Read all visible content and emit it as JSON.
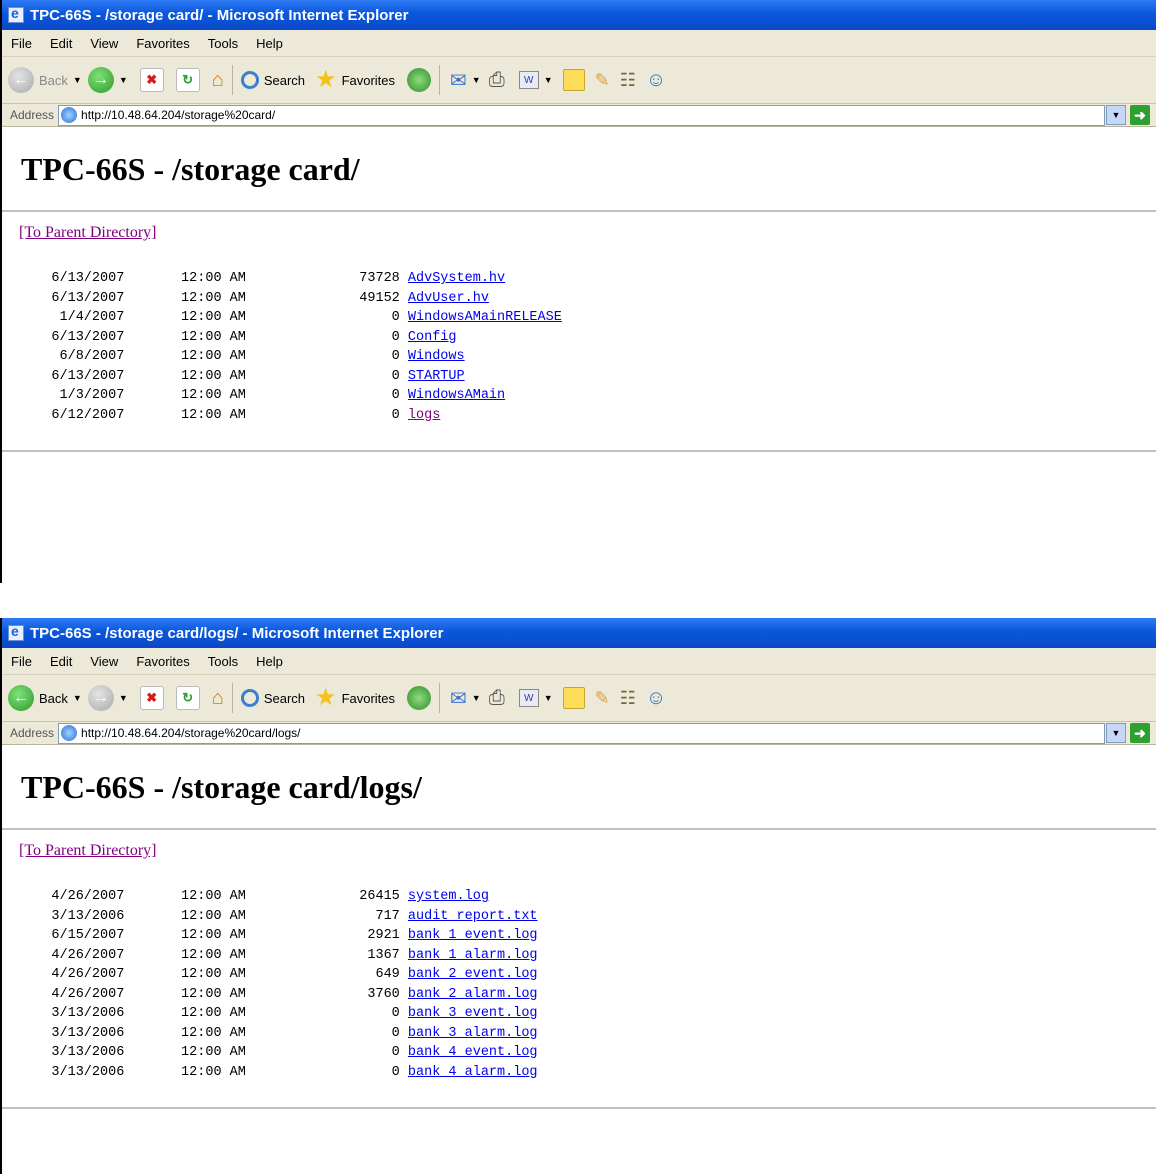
{
  "windows": [
    {
      "title": "TPC-66S - /storage card/ - Microsoft Internet Explorer",
      "address_label": "Address",
      "url": "http://10.48.64.204/storage%20card/",
      "heading": "TPC-66S - /storage card/",
      "parent_link": "[To Parent Directory]",
      "forward_enabled": true,
      "back_enabled": false,
      "rows": [
        {
          "date": "6/13/2007",
          "time": "12:00 AM",
          "size": "73728",
          "name": "AdvSystem.hv",
          "visited": false
        },
        {
          "date": "6/13/2007",
          "time": "12:00 AM",
          "size": "49152",
          "name": "AdvUser.hv",
          "visited": false
        },
        {
          "date": "1/4/2007",
          "time": "12:00 AM",
          "size": "0",
          "name": "WindowsAMainRELEASE",
          "visited": false
        },
        {
          "date": "6/13/2007",
          "time": "12:00 AM",
          "size": "0",
          "name": "Config",
          "visited": false
        },
        {
          "date": "6/8/2007",
          "time": "12:00 AM",
          "size": "0",
          "name": "Windows",
          "visited": false
        },
        {
          "date": "6/13/2007",
          "time": "12:00 AM",
          "size": "0",
          "name": "STARTUP",
          "visited": false
        },
        {
          "date": "1/3/2007",
          "time": "12:00 AM",
          "size": "0",
          "name": "WindowsAMain",
          "visited": false
        },
        {
          "date": "6/12/2007",
          "time": "12:00 AM",
          "size": "0",
          "name": "logs",
          "visited": true
        }
      ]
    },
    {
      "title": "TPC-66S - /storage card/logs/ - Microsoft Internet Explorer",
      "address_label": "Address",
      "url": "http://10.48.64.204/storage%20card/logs/",
      "heading": "TPC-66S - /storage card/logs/",
      "parent_link": "[To Parent Directory]",
      "forward_enabled": false,
      "back_enabled": true,
      "rows": [
        {
          "date": "4/26/2007",
          "time": "12:00 AM",
          "size": "26415",
          "name": "system.log",
          "visited": false
        },
        {
          "date": "3/13/2006",
          "time": "12:00 AM",
          "size": "717",
          "name": "audit_report.txt",
          "visited": false
        },
        {
          "date": "6/15/2007",
          "time": "12:00 AM",
          "size": "2921",
          "name": "bank_1_event.log",
          "visited": false
        },
        {
          "date": "4/26/2007",
          "time": "12:00 AM",
          "size": "1367",
          "name": "bank_1_alarm.log",
          "visited": false
        },
        {
          "date": "4/26/2007",
          "time": "12:00 AM",
          "size": "649",
          "name": "bank_2_event.log",
          "visited": false
        },
        {
          "date": "4/26/2007",
          "time": "12:00 AM",
          "size": "3760",
          "name": "bank_2_alarm.log",
          "visited": false
        },
        {
          "date": "3/13/2006",
          "time": "12:00 AM",
          "size": "0",
          "name": "bank_3_event.log",
          "visited": false
        },
        {
          "date": "3/13/2006",
          "time": "12:00 AM",
          "size": "0",
          "name": "bank_3_alarm.log",
          "visited": false
        },
        {
          "date": "3/13/2006",
          "time": "12:00 AM",
          "size": "0",
          "name": "bank_4_event.log",
          "visited": false
        },
        {
          "date": "3/13/2006",
          "time": "12:00 AM",
          "size": "0",
          "name": "bank_4_alarm.log",
          "visited": false
        }
      ]
    }
  ],
  "menu": [
    "File",
    "Edit",
    "View",
    "Favorites",
    "Tools",
    "Help"
  ],
  "toolbar": {
    "back": "Back",
    "search": "Search",
    "favorites": "Favorites"
  },
  "icons": [
    "back-icon",
    "forward-icon",
    "stop-icon",
    "refresh-icon",
    "home-icon",
    "search-icon",
    "favorites-star-icon",
    "history-icon",
    "mail-icon",
    "print-icon",
    "word-icon",
    "note-icon",
    "favorites-add-icon",
    "research-icon",
    "messenger-icon",
    "go-arrow-icon"
  ]
}
